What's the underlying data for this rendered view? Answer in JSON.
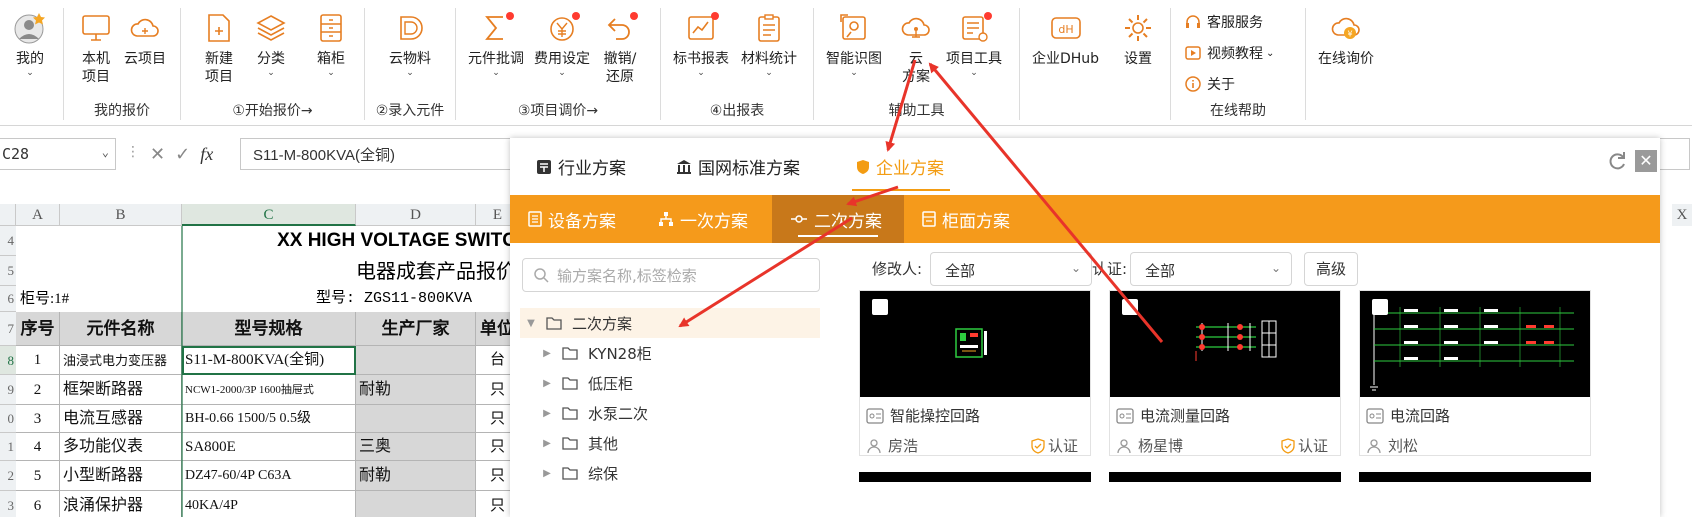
{
  "ribbon": {
    "groups": [
      {
        "label": "",
        "buttons": [
          {
            "label": "我的",
            "icon": "avatar-icon",
            "dropdown": true
          }
        ]
      },
      {
        "label": "我的报价",
        "buttons": [
          {
            "label": "本机\n项目",
            "icon": "monitor-icon",
            "dropdown": true
          },
          {
            "label": "云项目",
            "icon": "cloud-icon",
            "dropdown": false
          }
        ]
      },
      {
        "label": "①开始报价→",
        "buttons": [
          {
            "label": "新建\n项目",
            "icon": "new-file-icon"
          },
          {
            "label": "分类",
            "icon": "layers-icon",
            "dropdown": true
          },
          {
            "label": "箱柜",
            "icon": "cabinet-icon",
            "dropdown": true
          }
        ]
      },
      {
        "label": "②录入元件",
        "buttons": [
          {
            "label": "云物料",
            "icon": "cloud-material-icon",
            "dropdown": true
          }
        ]
      },
      {
        "label": "③项目调价→",
        "buttons": [
          {
            "label": "元件批调",
            "icon": "sigma-icon",
            "dropdown": true
          },
          {
            "label": "费用设定",
            "icon": "cost-icon",
            "dropdown": true
          },
          {
            "label": "撤销/\n还原",
            "icon": "undo-icon",
            "dropdown": true
          }
        ]
      },
      {
        "label": "④出报表",
        "buttons": [
          {
            "label": "标书报表",
            "icon": "bid-report-icon",
            "dropdown": true
          },
          {
            "label": "材料统计",
            "icon": "material-stats-icon",
            "dropdown": true
          }
        ]
      },
      {
        "label": "辅助工具",
        "buttons": [
          {
            "label": "智能识图",
            "icon": "smart-recognition-icon",
            "dropdown": true
          },
          {
            "label": "云\n方案",
            "icon": "cloud-scheme-icon"
          },
          {
            "label": "项目工具",
            "icon": "project-tools-icon",
            "dropdown": true
          }
        ]
      },
      {
        "label": "",
        "buttons": [
          {
            "label": "企业DHub",
            "icon": "dhub-icon"
          },
          {
            "label": "设置",
            "icon": "settings-icon"
          }
        ]
      },
      {
        "label": "在线帮助",
        "buttons": [
          {
            "label": "客服服务",
            "icon": "headset-icon"
          },
          {
            "label": "视频教程",
            "icon": "video-icon",
            "dropdown": true
          },
          {
            "label": "关于",
            "icon": "info-icon"
          }
        ]
      },
      {
        "label": "",
        "buttons": [
          {
            "label": "在线询价",
            "icon": "price-inquiry-icon"
          }
        ]
      }
    ]
  },
  "formula_bar": {
    "cell_ref": "C28",
    "formula": "S11-M-800KVA(全铜)",
    "fx": "fx"
  },
  "sheet": {
    "columns": [
      "A",
      "B",
      "C",
      "D",
      "E"
    ],
    "extra_column": "X",
    "row_numbers": [
      "4",
      "5",
      "6",
      "7",
      "8",
      "9",
      "0",
      "1",
      "2",
      "3"
    ],
    "title": "XX HIGH VOLTAGE SWITC",
    "subtitle": "电器成套产品报价",
    "cabinet_no": "柜号:1#",
    "model_label": "型号: ZGS11-800KVA",
    "headers": [
      "序号",
      "元件名称",
      "型号规格",
      "生产厂家",
      "单位"
    ],
    "rows": [
      {
        "no": "1",
        "name": "油浸式电力变压器",
        "spec": "S11-M-800KVA(全铜)",
        "maker": "",
        "unit": "台"
      },
      {
        "no": "2",
        "name": "框架断路器",
        "spec": "NCW1-2000/3P 1600抽屉式",
        "maker": "耐勒",
        "unit": "只"
      },
      {
        "no": "3",
        "name": "电流互感器",
        "spec": "BH-0.66 1500/5 0.5级",
        "maker": "",
        "unit": "只"
      },
      {
        "no": "4",
        "name": "多功能仪表",
        "spec": "SA800E",
        "maker": "三奥",
        "unit": "只"
      },
      {
        "no": "5",
        "name": "小型断路器",
        "spec": "DZ47-60/4P C63A",
        "maker": "耐勒",
        "unit": "只"
      },
      {
        "no": "6",
        "name": "浪涌保护器",
        "spec": "40KA/4P",
        "maker": "",
        "unit": "只"
      }
    ]
  },
  "dialog": {
    "top_tabs": [
      {
        "label": "行业方案",
        "icon": "industry-icon",
        "active": false
      },
      {
        "label": "国网标准方案",
        "icon": "bank-icon",
        "active": false
      },
      {
        "label": "企业方案",
        "icon": "shield-icon",
        "active": true
      }
    ],
    "sub_tabs": [
      {
        "label": "设备方案",
        "icon": "equipment-icon",
        "active": false
      },
      {
        "label": "一次方案",
        "icon": "hierarchy-icon",
        "active": false
      },
      {
        "label": "二次方案",
        "icon": "circuit-icon",
        "active": true
      },
      {
        "label": "柜面方案",
        "icon": "panel-icon",
        "active": false
      }
    ],
    "search_placeholder": "输方案名称,标签检索",
    "tree": [
      {
        "label": "二次方案",
        "level": 0,
        "expanded": true,
        "selected": true
      },
      {
        "label": "KYN28柜",
        "level": 1
      },
      {
        "label": "低压柜",
        "level": 1
      },
      {
        "label": "水泵二次",
        "level": 1
      },
      {
        "label": "其他",
        "level": 1
      },
      {
        "label": "综保",
        "level": 1
      }
    ],
    "filters": {
      "modifier_label": "修改人:",
      "modifier_value": "全部",
      "cert_label": "认证:",
      "cert_value": "全部",
      "advanced_label": "高级"
    },
    "cards": [
      {
        "name": "智能操控回路",
        "author": "房浩",
        "cert": "认证"
      },
      {
        "name": "电流测量回路",
        "author": "杨星博",
        "cert": "认证"
      },
      {
        "name": "电流回路",
        "author": "刘松",
        "cert": ""
      }
    ]
  },
  "colors": {
    "accent": "#f59a1b",
    "accent_dark": "#c8781a",
    "arrow": "#e8342a",
    "red_dot": "#ff3b30"
  }
}
